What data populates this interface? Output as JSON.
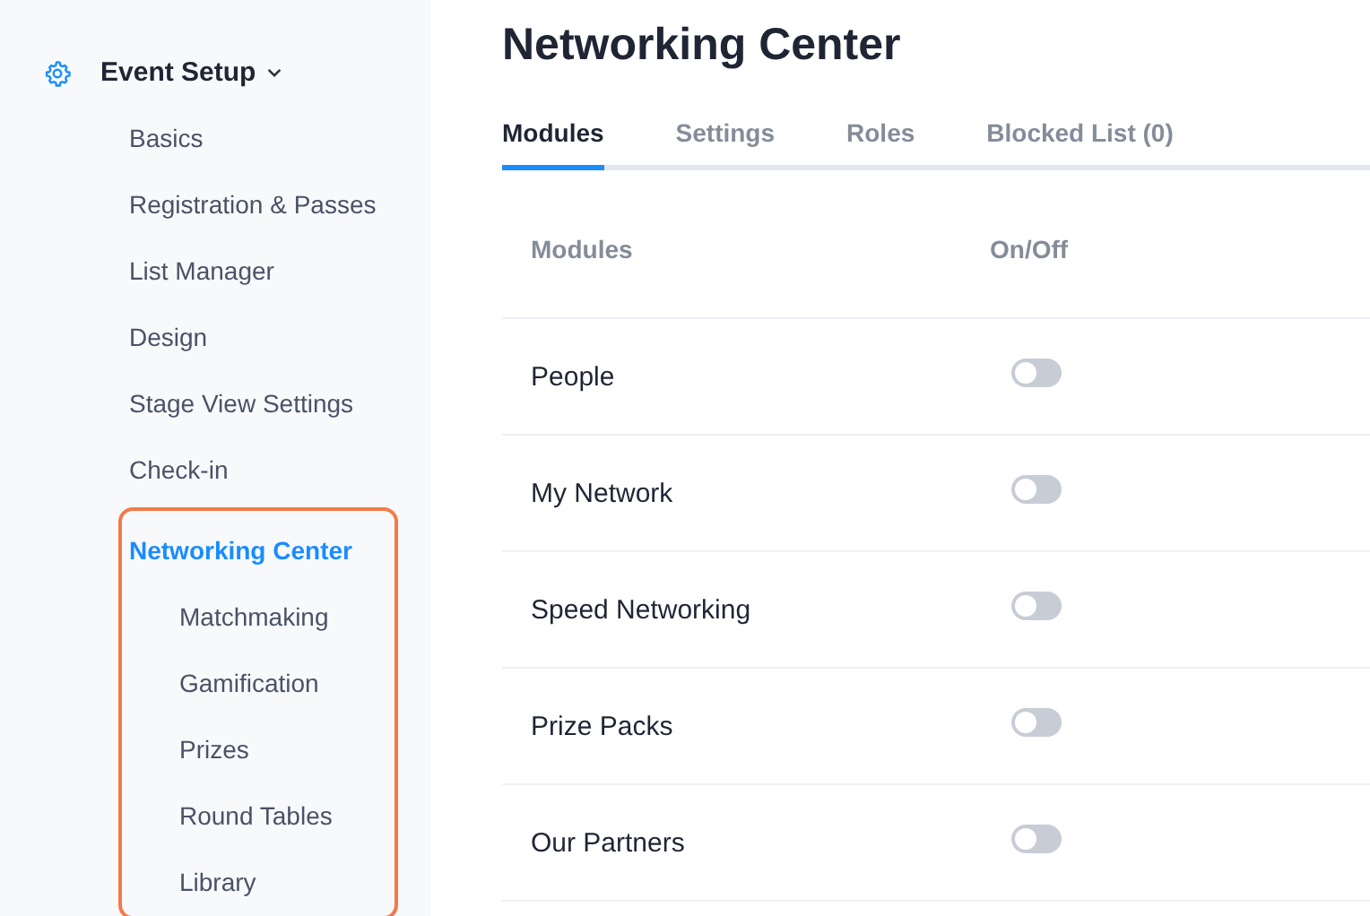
{
  "sidebar": {
    "section": {
      "label": "Event Setup",
      "expanded": true
    },
    "items": [
      {
        "label": "Basics",
        "selected": false
      },
      {
        "label": "Registration & Passes",
        "selected": false
      },
      {
        "label": "List Manager",
        "selected": false
      },
      {
        "label": "Design",
        "selected": false
      },
      {
        "label": "Stage View Settings",
        "selected": false
      },
      {
        "label": "Check-in",
        "selected": false
      }
    ],
    "highlighted_group": {
      "label": "Networking Center",
      "selected": true,
      "children": [
        {
          "label": "Matchmaking",
          "selected": false
        },
        {
          "label": "Gamification",
          "selected": false
        },
        {
          "label": "Prizes",
          "selected": false
        },
        {
          "label": "Round Tables",
          "selected": false
        },
        {
          "label": "Library",
          "selected": false
        }
      ]
    }
  },
  "page": {
    "title": "Networking Center",
    "tabs": [
      {
        "label": "Modules",
        "selected": true
      },
      {
        "label": "Settings",
        "selected": false
      },
      {
        "label": "Roles",
        "selected": false
      },
      {
        "label": "Blocked List (0)",
        "selected": false
      }
    ],
    "table": {
      "columns": [
        "Modules",
        "On/Off"
      ],
      "rows": [
        {
          "name": "People",
          "on": false
        },
        {
          "name": "My Network",
          "on": false
        },
        {
          "name": "Speed Networking",
          "on": false
        },
        {
          "name": "Prize Packs",
          "on": false
        },
        {
          "name": "Our Partners",
          "on": false
        }
      ]
    }
  }
}
